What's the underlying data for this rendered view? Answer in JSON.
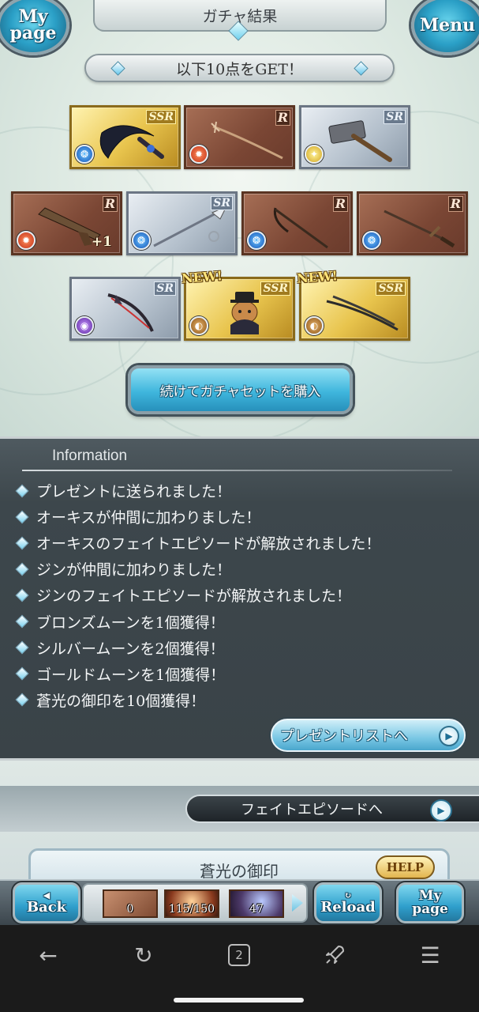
{
  "header": {
    "title": "ガチャ結果",
    "left_button": {
      "line1": "My",
      "line2": "page"
    },
    "right_button": "Menu"
  },
  "get_banner": "以下10点をGET！",
  "items": [
    {
      "rarity": "SSR",
      "element": "water",
      "is_new": false,
      "bonus": ""
    },
    {
      "rarity": "R",
      "element": "fire",
      "is_new": false,
      "bonus": ""
    },
    {
      "rarity": "SR",
      "element": "light",
      "is_new": false,
      "bonus": ""
    },
    {
      "rarity": "R",
      "element": "fire",
      "is_new": false,
      "bonus": "+1"
    },
    {
      "rarity": "SR",
      "element": "water",
      "is_new": false,
      "bonus": ""
    },
    {
      "rarity": "R",
      "element": "water",
      "is_new": false,
      "bonus": ""
    },
    {
      "rarity": "R",
      "element": "water",
      "is_new": false,
      "bonus": ""
    },
    {
      "rarity": "SR",
      "element": "dark",
      "is_new": false,
      "bonus": ""
    },
    {
      "rarity": "SSR",
      "element": "earth",
      "is_new": true,
      "bonus": ""
    },
    {
      "rarity": "SSR",
      "element": "earth",
      "is_new": true,
      "bonus": ""
    }
  ],
  "new_badge_label": "NEW!",
  "gacha_again_button": "続けてガチャセットを購入",
  "information": {
    "heading": "Information",
    "messages": [
      "プレゼントに送られました！",
      "オーキスが仲間に加わりました！",
      "オーキスのフェイトエピソードが解放されました！",
      "ジンが仲間に加わりました！",
      "ジンのフェイトエピソードが解放されました！",
      "ブロンズムーンを1個獲得！",
      "シルバームーンを2個獲得！",
      "ゴールドムーンを1個獲得！",
      "蒼光の御印を10個獲得！"
    ],
    "present_list_button": "プレゼントリストへ"
  },
  "fate_episode_button": "フェイトエピソードへ",
  "seal_panel": {
    "title": "蒼光の御印",
    "help_button": "HELP"
  },
  "toolbar": {
    "back": "Back",
    "reload": "Reload",
    "mypage_line1": "My",
    "mypage_line2": "page",
    "stats": [
      "0",
      "115/150",
      "47"
    ]
  },
  "android_nav": {
    "back_icon": "back-arrow-icon",
    "reload_icon": "reload-icon",
    "tabs_count": "2",
    "rocket_icon": "rocket-icon",
    "menu_icon": "hamburger-menu-icon"
  },
  "colors": {
    "accent_blue": "#3fb6dd",
    "info_panel": "#3d474c",
    "ssr_gold": "#e8c44d",
    "sr_silver": "#b4c0cc",
    "r_bronze": "#7a4634"
  }
}
